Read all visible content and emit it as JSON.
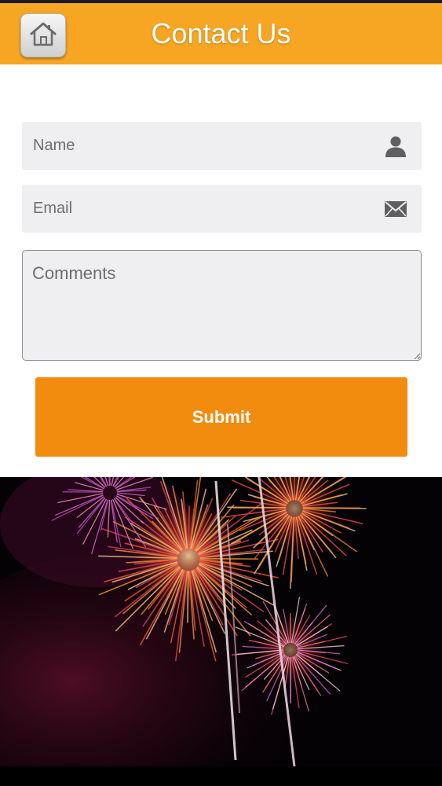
{
  "header": {
    "title": "Contact Us",
    "home_icon": "home-icon",
    "background_color": "#f6a623"
  },
  "form": {
    "name_placeholder": "Name",
    "name_value": "",
    "name_icon": "person-icon",
    "email_placeholder": "Email",
    "email_value": "",
    "email_icon": "envelope-icon",
    "comments_placeholder": "Comments",
    "comments_value": "",
    "submit_label": "Submit",
    "submit_color": "#f28c0f"
  },
  "background": {
    "image": "fireworks-photo"
  }
}
